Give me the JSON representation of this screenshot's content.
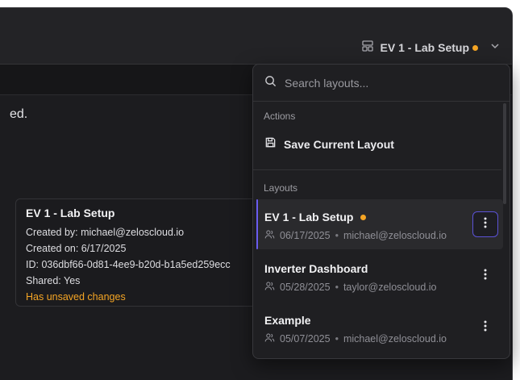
{
  "header": {
    "current_layout": "EV 1 - Lab Setup",
    "layout_icon": "layout-icon",
    "chevron_icon": "chevron-down-icon",
    "unsaved_color": "#f5a524"
  },
  "background": {
    "partial_text": "ed."
  },
  "tooltip": {
    "title": "EV 1 - Lab Setup",
    "created_by": "Created by: michael@zeloscloud.io",
    "created_on": "Created on: 6/17/2025",
    "id": "ID: 036dbf66-0d81-4ee9-b20d-b1a5ed259ecc",
    "shared": "Shared: Yes",
    "unsaved": "Has unsaved changes"
  },
  "dropdown": {
    "search_placeholder": "Search layouts...",
    "actions_label": "Actions",
    "save_label": "Save Current Layout",
    "layouts_label": "Layouts",
    "layouts": [
      {
        "name": "EV 1 - Lab Setup",
        "date": "06/17/2025",
        "owner": "michael@zeloscloud.io",
        "active": true,
        "unsaved": true
      },
      {
        "name": "Inverter Dashboard",
        "date": "05/28/2025",
        "owner": "taylor@zeloscloud.io",
        "active": false,
        "unsaved": false
      },
      {
        "name": "Example",
        "date": "05/07/2025",
        "owner": "michael@zeloscloud.io",
        "active": false,
        "unsaved": false
      }
    ]
  },
  "accent_color": "#6a5cf0"
}
